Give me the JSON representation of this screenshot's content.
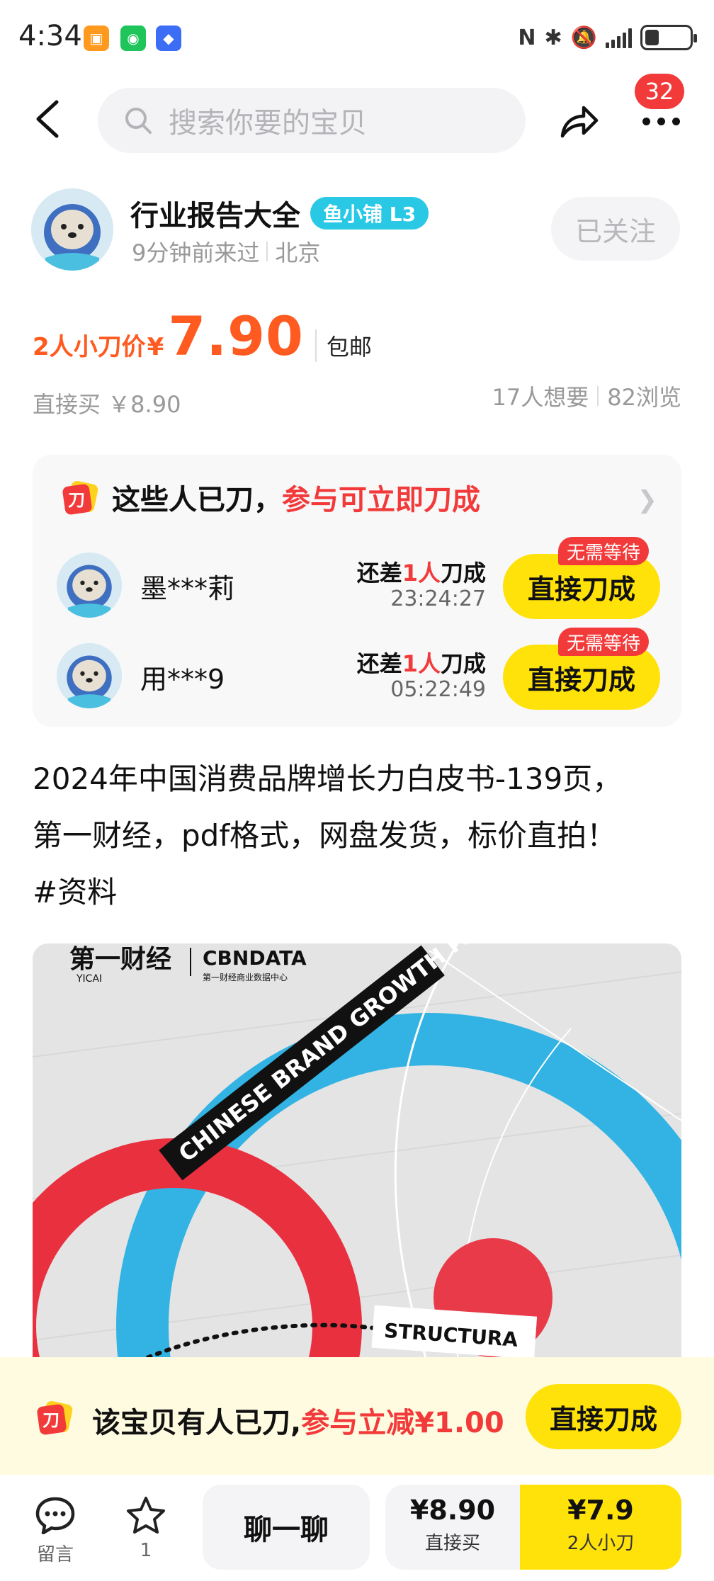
{
  "status_bar": {
    "time": "4:34",
    "app_icons": [
      "taobao-like-icon",
      "wechat-icon",
      "xianyu-icon"
    ],
    "icons": [
      "nfc-icon",
      "bluetooth-icon",
      "mute-icon",
      "signal-icon",
      "battery-icon"
    ],
    "battery_level": 0.3
  },
  "header": {
    "search_placeholder": "搜索你要的宝贝",
    "badge_count": "32"
  },
  "seller": {
    "name": "行业报告大全",
    "badge": "鱼小铺 L3",
    "last_seen": "9分钟前来过",
    "location": "北京",
    "follow_label": "已关注"
  },
  "price": {
    "label": "2人小刀价",
    "currency": "¥",
    "amount": "7.90",
    "shipping": "包邮",
    "direct_buy": "直接买 ￥8.90",
    "wants": "17人想要",
    "views": "82浏览"
  },
  "cut_card": {
    "title": "这些人已刀，",
    "title_red": "参与可立即刀成",
    "rows": [
      {
        "user": "墨***莉",
        "need_prefix": "还差",
        "need_num": "1人",
        "need_suffix": "刀成",
        "timer": "23:24:27",
        "tag": "无需等待",
        "button": "直接刀成"
      },
      {
        "user": "用***9",
        "need_prefix": "还差",
        "need_num": "1人",
        "need_suffix": "刀成",
        "timer": "05:22:49",
        "tag": "无需等待",
        "button": "直接刀成"
      }
    ]
  },
  "description": {
    "line1": "2024年中国消费品牌增长力白皮书-139页，",
    "line2": "第一财经，pdf格式，网盘发货，标价直拍！",
    "line3": "#资料"
  },
  "product_image": {
    "logo_left": "第一财经",
    "logo_sub": "YICAI",
    "logo_right": "CBNDATA",
    "logo_right_sub": "第一财经商业数据中心",
    "ribbon": "CHINESE BRAND GROWTH PATH",
    "label": "STRUCTURA",
    "colors": {
      "blue": "#32b3e3",
      "red": "#e8303f",
      "background": "#e4e4e4"
    }
  },
  "promo_banner": {
    "text": "该宝贝有人已刀,",
    "text_red": "参与立减¥1.00",
    "button": "直接刀成"
  },
  "bottom_bar": {
    "message_label": "留言",
    "favorite_count": "1",
    "chat_label": "聊一聊",
    "direct_price": "¥8.90",
    "direct_label": "直接买",
    "cut_price": "¥7.9",
    "cut_label": "2人小刀"
  }
}
